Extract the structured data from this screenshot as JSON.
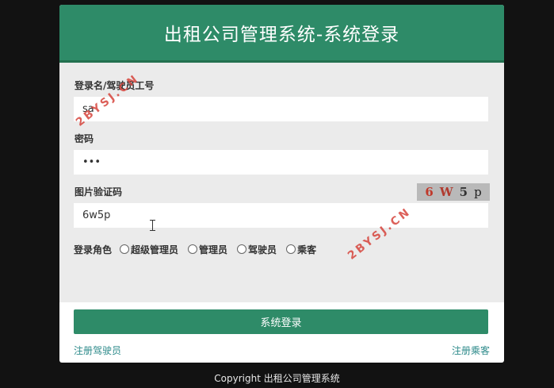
{
  "header": {
    "title": "出租公司管理系统-系统登录"
  },
  "form": {
    "username": {
      "label": "登录名/驾驶员工号",
      "value": "sa"
    },
    "password": {
      "label": "密码",
      "value": "•••"
    },
    "captcha": {
      "label": "图片验证码",
      "value": "6w5p",
      "image_chars": [
        "6",
        "W",
        "5",
        "p"
      ]
    },
    "role": {
      "label": "登录角色",
      "options": [
        "超级管理员",
        "管理员",
        "驾驶员",
        "乘客"
      ]
    }
  },
  "actions": {
    "login_label": "系统登录",
    "register_driver": "注册驾驶员",
    "register_passenger": "注册乘客"
  },
  "footer": {
    "copyright": "Copyright 出租公司管理系统"
  },
  "watermark": {
    "text": "2BYSJ.CN"
  },
  "colors": {
    "primary": "#2e8b68",
    "link": "#2e8b8b",
    "background": "#121212"
  }
}
